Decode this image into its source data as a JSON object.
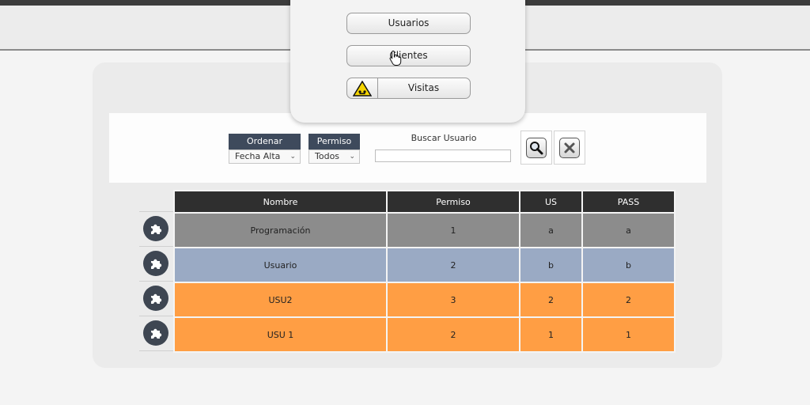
{
  "menu": {
    "items": [
      {
        "label": "Usuarios",
        "icon": ""
      },
      {
        "label": "Clientes",
        "icon": "cursor-hand-icon"
      },
      {
        "label": "Visitas",
        "icon": "warning-sign-icon"
      }
    ]
  },
  "filters": {
    "order": {
      "label": "Ordenar",
      "value": "Fecha Alta"
    },
    "permission": {
      "label": "Permiso",
      "value": "Todos"
    },
    "search": {
      "label": "Buscar Usuario",
      "placeholder": "",
      "value": ""
    }
  },
  "actions": {
    "search_icon": "magnifier-icon",
    "clear_icon": "close-x-icon"
  },
  "table": {
    "columns": [
      "Nombre",
      "Permiso",
      "US",
      "PASS"
    ],
    "rows": [
      {
        "nombre": "Programación",
        "permiso": "1",
        "us": "a",
        "pass": "a",
        "color": "#8c8c8c"
      },
      {
        "nombre": "Usuario",
        "permiso": "2",
        "us": "b",
        "pass": "b",
        "color": "#9aaac4"
      },
      {
        "nombre": "USU2",
        "permiso": "3",
        "us": "2",
        "pass": "2",
        "color": "#ff9e44"
      },
      {
        "nombre": "USU 1",
        "permiso": "2",
        "us": "1",
        "pass": "1",
        "color": "#ff9e44"
      }
    ],
    "row_action_icon": "puzzle-piece-icon"
  },
  "colors": {
    "header_dark": "#2f2f2f",
    "select_head": "#3e4a5c",
    "row_button": "#3e4652"
  }
}
